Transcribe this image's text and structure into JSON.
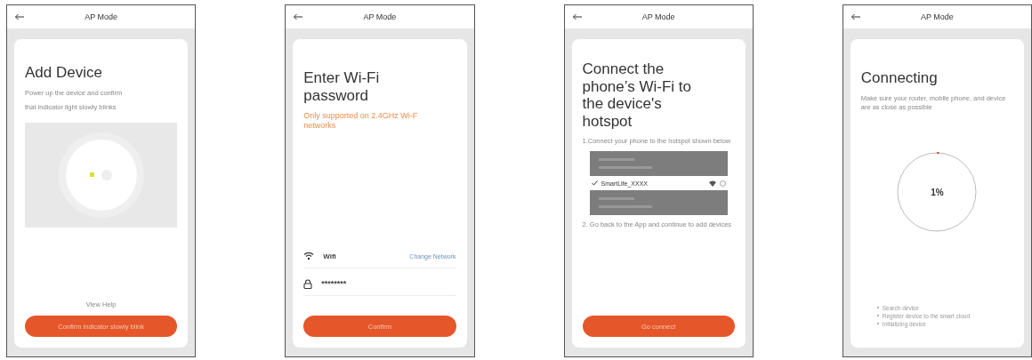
{
  "screens": [
    {
      "kind": "add_device",
      "nav_title": "AP Mode",
      "title": "Add Device",
      "lines": [
        "Power up the device and confirm",
        "that indicator light slowly blinks"
      ],
      "help_link": "View Help",
      "button": "Confirm indicator slowly blink"
    },
    {
      "kind": "wifi_password",
      "nav_title": "AP Mode",
      "title": "Enter Wi-Fi password",
      "warning": [
        "Only supported on 2.4GHz Wi-F",
        "networks"
      ],
      "ssid": "Wifi",
      "change_link": "Change Network",
      "password": "********",
      "button": "Confirm"
    },
    {
      "kind": "hotspot",
      "nav_title": "AP Mode",
      "title": "Connect the phone’s Wi-Fi to the device's hotspot",
      "step_1": "1.Connect your phone to the hotspot shown below",
      "network": {
        "name": "SmartLife_XXXX",
        "checked": true
      },
      "step_2": "2. Go back to the App and continue to add devices",
      "button": "Go connect"
    },
    {
      "kind": "connecting",
      "nav_title": "AP Mode",
      "title": "Connecting",
      "note": "Make sure your router, mobile phone, and device are as close as possible",
      "progress": {
        "level": 0.01,
        "reading": "1%"
      },
      "steps": [
        "Search device",
        "Register device to the smart cloud",
        "Initializing device"
      ]
    }
  ]
}
